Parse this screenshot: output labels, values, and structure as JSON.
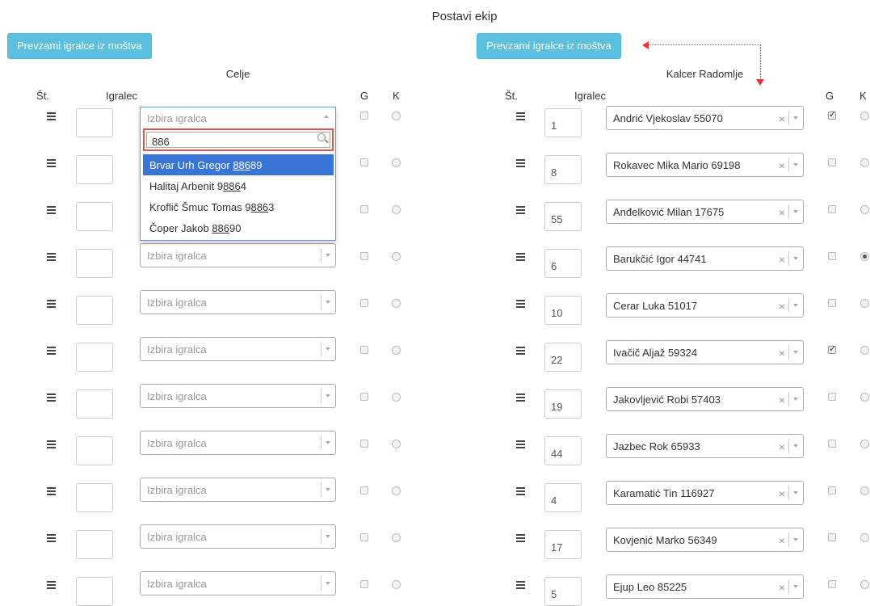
{
  "page": {
    "title": "Postavi ekip"
  },
  "left": {
    "import_label": "Prevzami igralce iz moštva",
    "team": "Celje",
    "headers": {
      "no": "Št.",
      "player": "Igralec",
      "g": "G",
      "k": "K"
    },
    "select_placeholder": "Izbira igralca",
    "dropdown": {
      "search_value": "886",
      "options": [
        {
          "pre": "Brvar Urh Gregor ",
          "hl": "886",
          "post": "89",
          "active": true
        },
        {
          "pre": "Halitaj Arbenit 9",
          "hl": "886",
          "post": "4",
          "active": false
        },
        {
          "pre": "Kroflič Šmuc Tomas 9",
          "hl": "886",
          "post": "3",
          "active": false
        },
        {
          "pre": "Čoper Jakob ",
          "hl": "886",
          "post": "90",
          "active": false
        }
      ]
    },
    "rows": 11
  },
  "right": {
    "import_label": "Prevzami igralce iz moštva",
    "team": "Kalcer Radomlje",
    "headers": {
      "no": "Št.",
      "player": "Igralec",
      "g": "G",
      "k": "K"
    },
    "players": [
      {
        "no": "1",
        "name": "Andrić Vjekoslav 55070",
        "g": true,
        "k": false
      },
      {
        "no": "8",
        "name": "Rokavec Mika Mario 69198",
        "g": false,
        "k": false
      },
      {
        "no": "55",
        "name": "Anđelković Milan 17675",
        "g": false,
        "k": false
      },
      {
        "no": "6",
        "name": "Barukčić Igor 44741",
        "g": false,
        "k": true
      },
      {
        "no": "10",
        "name": "Cerar Luka 51017",
        "g": false,
        "k": false
      },
      {
        "no": "22",
        "name": "Ivačič Aljaž 59324",
        "g": true,
        "k": false
      },
      {
        "no": "19",
        "name": "Jakovljević Robi 57403",
        "g": false,
        "k": false
      },
      {
        "no": "44",
        "name": "Jazbec Rok 65933",
        "g": false,
        "k": false
      },
      {
        "no": "4",
        "name": "Karamatić Tin 116927",
        "g": false,
        "k": false
      },
      {
        "no": "17",
        "name": "Kovjenić Marko 56349",
        "g": false,
        "k": false
      },
      {
        "no": "5",
        "name": "Ejup Leo 85225",
        "g": false,
        "k": false
      }
    ]
  },
  "icons": {
    "reorder": "reorder-icon",
    "search": "search-icon",
    "clear": "clear-icon",
    "arrow": "chevron-down-icon"
  },
  "colors": {
    "button": "#5bc0de",
    "highlight": "#3875d7",
    "annotation": "#dd3333"
  }
}
